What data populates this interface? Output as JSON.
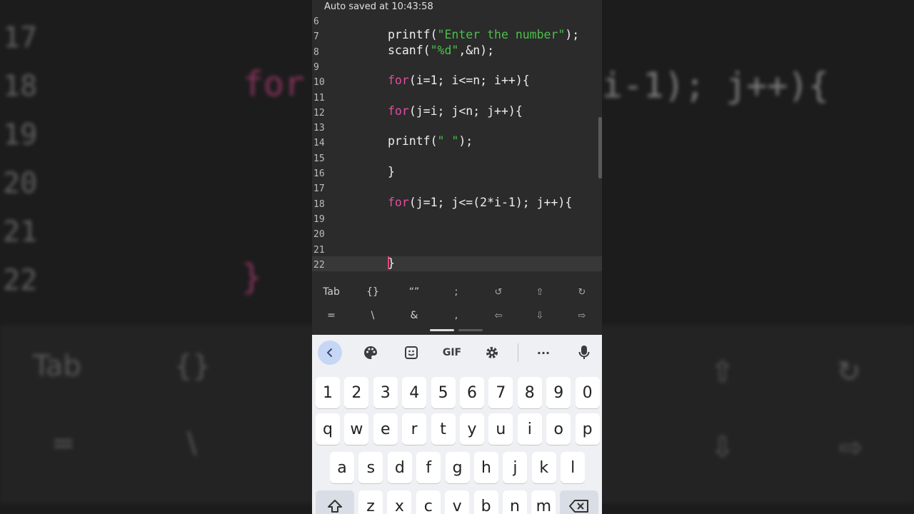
{
  "status_bar": {
    "text": "Auto saved at 10:43:58"
  },
  "editor": {
    "lines": [
      {
        "num": "6"
      },
      {
        "num": "7",
        "tokens": [
          [
            "printf(",
            "p"
          ],
          [
            "\"Enter the number\"",
            "s"
          ],
          [
            ");",
            "p"
          ]
        ]
      },
      {
        "num": "8",
        "tokens": [
          [
            "scanf(",
            "p"
          ],
          [
            "\"%d\"",
            "s"
          ],
          [
            ",&n);",
            "p"
          ]
        ]
      },
      {
        "num": "9"
      },
      {
        "num": "10",
        "tokens": [
          [
            "for",
            "k"
          ],
          [
            "(i=1; i<=n; i++){",
            "p"
          ]
        ]
      },
      {
        "num": "11"
      },
      {
        "num": "12",
        "tokens": [
          [
            "for",
            "k"
          ],
          [
            "(j=i; j<n; j++){",
            "p"
          ]
        ]
      },
      {
        "num": "13"
      },
      {
        "num": "14",
        "tokens": [
          [
            "printf(",
            "p"
          ],
          [
            "\" \"",
            "s"
          ],
          [
            ");",
            "p"
          ]
        ]
      },
      {
        "num": "15"
      },
      {
        "num": "16",
        "tokens": [
          [
            "}",
            "p"
          ]
        ]
      },
      {
        "num": "17"
      },
      {
        "num": "18",
        "tokens": [
          [
            "for",
            "k"
          ],
          [
            "(j=1; j<=(2*i-1); j++){",
            "p"
          ]
        ]
      },
      {
        "num": "19"
      },
      {
        "num": "20"
      },
      {
        "num": "21"
      },
      {
        "num": "22",
        "current": true,
        "cursor": true,
        "tokens": [
          [
            "}",
            "p"
          ]
        ]
      }
    ]
  },
  "extra_keys": {
    "row1": [
      "Tab",
      "{}",
      "“”",
      ";",
      "↺",
      "⇧",
      "↻"
    ],
    "row2": [
      "=",
      "\\",
      "&",
      ",",
      "⇦",
      "⇩",
      "⇨"
    ]
  },
  "keyboard": {
    "toolbar": [
      "back-icon",
      "palette-icon",
      "sticker-icon",
      "GIF",
      "gear-icon",
      "more-icon",
      "mic-icon"
    ],
    "gif_label": "GIF",
    "more_label": "···",
    "numbers": [
      "1",
      "2",
      "3",
      "4",
      "5",
      "6",
      "7",
      "8",
      "9",
      "0"
    ],
    "row1": [
      "q",
      "w",
      "e",
      "r",
      "t",
      "y",
      "u",
      "i",
      "o",
      "p"
    ],
    "row2": [
      "a",
      "s",
      "d",
      "f",
      "g",
      "h",
      "j",
      "k",
      "l"
    ],
    "row3": [
      "z",
      "x",
      "c",
      "v",
      "b",
      "n",
      "m"
    ]
  },
  "background": {
    "line_numbers": [
      "17",
      "18",
      "19",
      "20",
      "21",
      "22"
    ],
    "left_code": [
      "for",
      "}"
    ],
    "right_code": "i-1); j++){",
    "tools": [
      "Tab",
      "{}",
      "⇧",
      "↻",
      "=",
      "\\",
      "⇩",
      "⇨"
    ]
  },
  "colors": {
    "keyword": "#e14fa0",
    "string": "#4cbf4c",
    "text": "#eeeeee",
    "cursor": "#e0467a",
    "editor_bg": "#2b2b2b",
    "keyboard_bg": "#eef0f4"
  }
}
